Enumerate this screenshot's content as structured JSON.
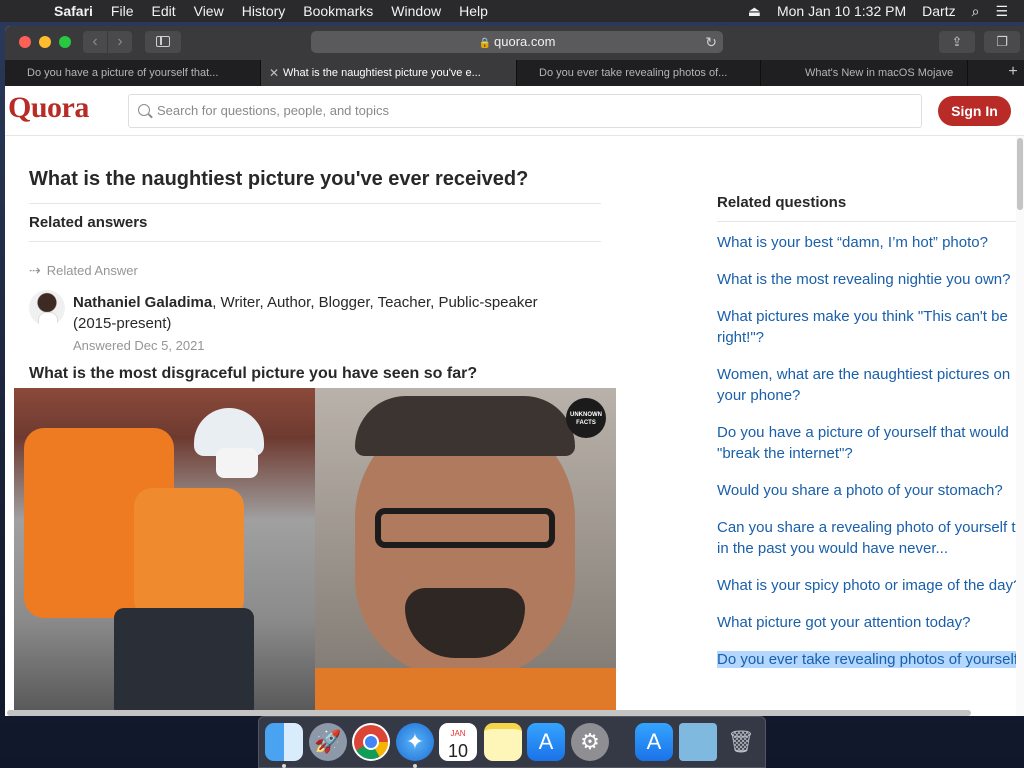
{
  "menubar": {
    "apple": "",
    "app": "Safari",
    "items": [
      "File",
      "Edit",
      "View",
      "History",
      "Bookmarks",
      "Window",
      "Help"
    ],
    "datetime": "Mon Jan 10  1:32 PM",
    "user": "Dartz"
  },
  "browser": {
    "url": "quora.com",
    "tabs": [
      {
        "label": "Do you have a picture of yourself that..."
      },
      {
        "label": "What is the naughtiest picture you've e..."
      },
      {
        "label": "Do you ever take revealing photos of..."
      },
      {
        "label": "What's New in macOS Mojave"
      }
    ],
    "new_tab": "+"
  },
  "quora": {
    "logo": "Quora",
    "search_placeholder": "Search for questions, people, and topics",
    "signin": "Sign In",
    "question_title": "What is the naughtiest picture you've ever received?",
    "related_answers": "Related answers",
    "related_answer_label": "Related Answer",
    "author_name": "Nathaniel Galadima",
    "author_bio": ", Writer, Author, Blogger, Teacher, Public-speaker (2015-present)",
    "answered": "Answered Dec 5, 2021",
    "answer_question": "What is the most disgraceful picture you have seen so far?",
    "photo_badge": "UNKNOWN FACTS",
    "related_questions_title": "Related questions",
    "related_questions": [
      "What is your best “damn, I’m hot” photo?",
      "What is the most revealing nightie you own?",
      "What pictures make you think \"This can't be right!\"?",
      "Women, what are the naughtiest pictures on your phone?",
      "Do you have a picture of yourself that would \"break the internet\"?",
      "Would you share a photo of your stomach?",
      "Can you share a revealing photo of yourself that in the past you would have never...",
      "What is your spicy photo or image of the day?",
      "What picture got your attention today?",
      "Do you ever take revealing photos of yourself?"
    ]
  },
  "dock": {
    "calendar_month": "JAN",
    "calendar_day": "10"
  }
}
